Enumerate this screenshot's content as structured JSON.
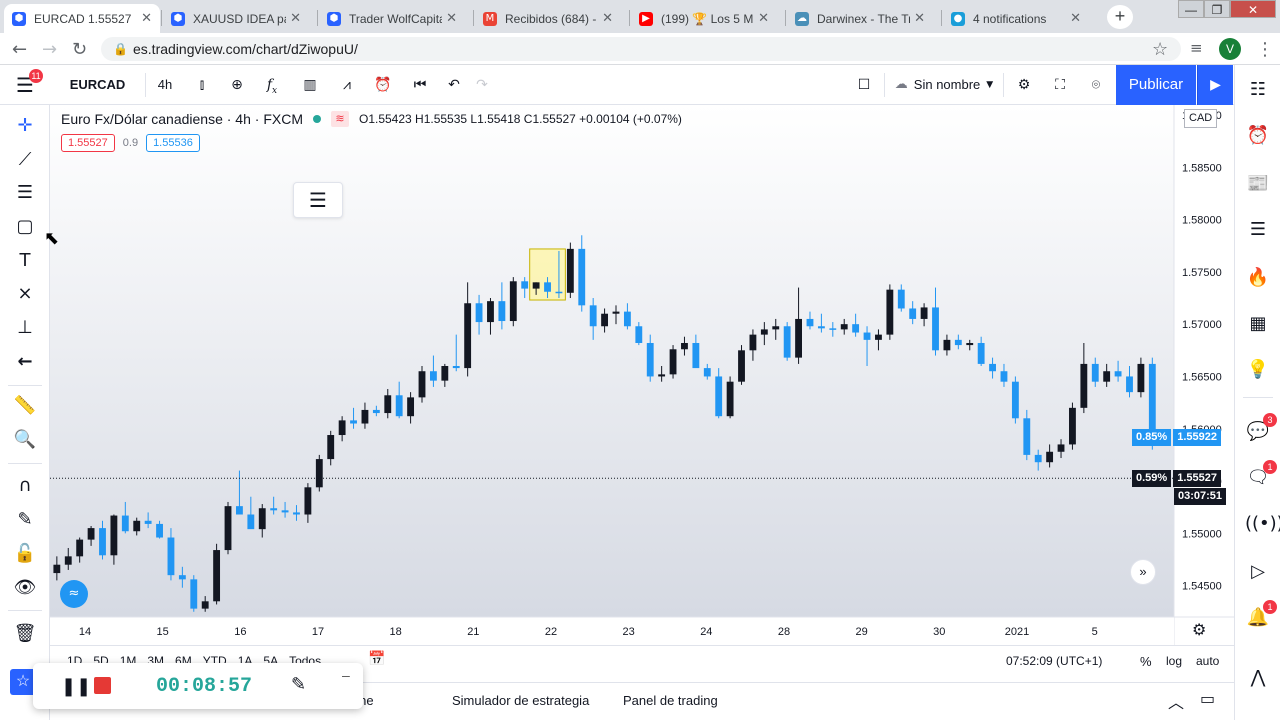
{
  "browser": {
    "tabs": [
      {
        "title": "EURCAD 1.55527 ▼",
        "favicon": "tradingview-icon",
        "color": "#2962ff"
      },
      {
        "title": "XAUUSD IDEA para",
        "favicon": "tradingview-icon",
        "color": "#2962ff"
      },
      {
        "title": "Trader WolfCapital",
        "favicon": "tradingview-icon",
        "color": "#2962ff"
      },
      {
        "title": "Recibidos (684) - s",
        "favicon": "gmail-icon",
        "color": "#ea4335"
      },
      {
        "title": "(199) 🏆 Los 5 MEJ",
        "favicon": "youtube-icon",
        "color": "#ff0000"
      },
      {
        "title": "Darwinex - The Tra",
        "favicon": "darwinex-icon",
        "color": "#4a90b8"
      },
      {
        "title": "4 notifications",
        "favicon": "notification-icon",
        "color": "#1a9ed9"
      }
    ],
    "url": "es.tradingview.com/chart/dZiwopuU/",
    "avatar_letter": "V"
  },
  "toolbar": {
    "symbol": "EURCAD",
    "interval": "4h",
    "layout_name": "Sin nombre",
    "publish": "Publicar"
  },
  "legend": {
    "title": "Euro Fx/Dólar canadiense · 4h · FXCM",
    "ohlc": "O1.55423 H1.55535 L1.55418 C1.55527 +0.00104 (+0.07%)",
    "bid": "1.55527",
    "spread": "0.9",
    "ask": "1.55536"
  },
  "price_axis": {
    "currency": "CAD",
    "ticks": [
      "1.58500",
      "1.58000",
      "1.57500",
      "1.57000",
      "1.56500",
      "1.56000",
      "1.55500",
      "1.55000",
      "1.54500"
    ],
    "partial_top": "1.59000",
    "marker1_pct": "0.85%",
    "marker1_price": "1.55922",
    "marker2_pct": "0.59%",
    "marker2_price": "1.55527",
    "countdown": "03:07:51"
  },
  "time_axis": {
    "ticks": [
      "14",
      "15",
      "16",
      "17",
      "18",
      "21",
      "22",
      "23",
      "24",
      "28",
      "29",
      "30",
      "2021",
      "5"
    ]
  },
  "bottom": {
    "ranges": [
      "1D",
      "5D",
      "1M",
      "3M",
      "6M",
      "YTD",
      "1A",
      "5A",
      "Todos"
    ],
    "clock": "07:52:09 (UTC+1)",
    "percent": "%",
    "log": "log",
    "auto": "auto"
  },
  "bottom_tabs": [
    "Editor Pine",
    "Simulador de estrategia",
    "Panel de trading"
  ],
  "recorder": {
    "time": "00:08:57"
  },
  "left_badge": "11",
  "right_badges": [
    "3",
    "1",
    "1"
  ],
  "colors": {
    "up": "#131722",
    "down": "#2196f3",
    "accent": "#2962ff",
    "highlight": "#fff59d"
  },
  "chart_data": {
    "type": "candlestick",
    "title": "Euro Fx/Dólar canadiense · 4h · FXCM",
    "ylim": [
      1.542,
      1.59
    ],
    "series": [
      {
        "name": "EURCAD",
        "values": [
          [
            1.5462,
            1.5478,
            1.5455,
            1.547
          ],
          [
            1.547,
            1.5486,
            1.5465,
            1.5478
          ],
          [
            1.5478,
            1.5496,
            1.5472,
            1.5494
          ],
          [
            1.5494,
            1.5507,
            1.5488,
            1.5505
          ],
          [
            1.5505,
            1.5512,
            1.5475,
            1.5479
          ],
          [
            1.5479,
            1.5518,
            1.547,
            1.5517
          ],
          [
            1.5517,
            1.553,
            1.55,
            1.5502
          ],
          [
            1.5502,
            1.5515,
            1.5498,
            1.5512
          ],
          [
            1.5512,
            1.552,
            1.5505,
            1.5509
          ],
          [
            1.5509,
            1.5512,
            1.5495,
            1.5496
          ],
          [
            1.5496,
            1.5505,
            1.5455,
            1.546
          ],
          [
            1.546,
            1.5468,
            1.5448,
            1.5456
          ],
          [
            1.5456,
            1.546,
            1.5425,
            1.5428
          ],
          [
            1.5428,
            1.544,
            1.5425,
            1.5435
          ],
          [
            1.5435,
            1.549,
            1.5432,
            1.5484
          ],
          [
            1.5484,
            1.553,
            1.548,
            1.5526
          ],
          [
            1.5526,
            1.556,
            1.5518,
            1.5518
          ],
          [
            1.5518,
            1.5535,
            1.551,
            1.5504
          ],
          [
            1.5504,
            1.5528,
            1.5496,
            1.5524
          ],
          [
            1.5524,
            1.5535,
            1.5518,
            1.5522
          ],
          [
            1.5522,
            1.553,
            1.5515,
            1.552
          ],
          [
            1.552,
            1.5527,
            1.5512,
            1.5518
          ],
          [
            1.5518,
            1.5548,
            1.551,
            1.5544
          ],
          [
            1.5544,
            1.5575,
            1.554,
            1.5571
          ],
          [
            1.5571,
            1.5598,
            1.5565,
            1.5594
          ],
          [
            1.5594,
            1.5612,
            1.5588,
            1.5608
          ],
          [
            1.5608,
            1.562,
            1.56,
            1.5605
          ],
          [
            1.5605,
            1.5625,
            1.56,
            1.5618
          ],
          [
            1.5618,
            1.5622,
            1.5612,
            1.5615
          ],
          [
            1.5615,
            1.5638,
            1.561,
            1.5632
          ],
          [
            1.5632,
            1.5645,
            1.561,
            1.5612
          ],
          [
            1.5612,
            1.5635,
            1.5605,
            1.563
          ],
          [
            1.563,
            1.566,
            1.5625,
            1.5655
          ],
          [
            1.5655,
            1.567,
            1.564,
            1.5646
          ],
          [
            1.5646,
            1.5662,
            1.564,
            1.566
          ],
          [
            1.566,
            1.569,
            1.5655,
            1.5658
          ],
          [
            1.5658,
            1.574,
            1.565,
            1.572
          ],
          [
            1.572,
            1.5728,
            1.569,
            1.5702
          ],
          [
            1.5702,
            1.5725,
            1.569,
            1.5722
          ],
          [
            1.5722,
            1.574,
            1.5695,
            1.5703
          ],
          [
            1.5703,
            1.5745,
            1.5698,
            1.5741
          ],
          [
            1.5741,
            1.5745,
            1.5725,
            1.5734
          ],
          [
            1.5734,
            1.574,
            1.5728,
            1.574
          ],
          [
            1.574,
            1.5745,
            1.5725,
            1.5731
          ],
          [
            1.5731,
            1.577,
            1.5725,
            1.573
          ],
          [
            1.573,
            1.5778,
            1.5725,
            1.5772
          ],
          [
            1.5772,
            1.5785,
            1.5712,
            1.5718
          ],
          [
            1.5718,
            1.5725,
            1.5685,
            1.5698
          ],
          [
            1.5698,
            1.5715,
            1.5692,
            1.571
          ],
          [
            1.571,
            1.5718,
            1.57,
            1.5712
          ],
          [
            1.5712,
            1.572,
            1.5695,
            1.5698
          ],
          [
            1.5698,
            1.5702,
            1.568,
            1.5682
          ],
          [
            1.5682,
            1.569,
            1.5645,
            1.565
          ],
          [
            1.565,
            1.566,
            1.5645,
            1.5652
          ],
          [
            1.5652,
            1.568,
            1.5648,
            1.5676
          ],
          [
            1.5676,
            1.5688,
            1.567,
            1.5682
          ],
          [
            1.5682,
            1.569,
            1.566,
            1.5658
          ],
          [
            1.5658,
            1.5662,
            1.5647,
            1.565
          ],
          [
            1.565,
            1.5658,
            1.561,
            1.5612
          ],
          [
            1.5612,
            1.565,
            1.561,
            1.5645
          ],
          [
            1.5645,
            1.568,
            1.5642,
            1.5675
          ],
          [
            1.5675,
            1.5695,
            1.5665,
            1.569
          ],
          [
            1.569,
            1.5702,
            1.568,
            1.5695
          ],
          [
            1.5695,
            1.5705,
            1.5685,
            1.5698
          ],
          [
            1.5698,
            1.5702,
            1.5665,
            1.5668
          ],
          [
            1.5668,
            1.5735,
            1.5662,
            1.5705
          ],
          [
            1.5705,
            1.5712,
            1.5695,
            1.5698
          ],
          [
            1.5698,
            1.571,
            1.5692,
            1.5696
          ],
          [
            1.5696,
            1.5702,
            1.5688,
            1.5695
          ],
          [
            1.5695,
            1.5705,
            1.569,
            1.57
          ],
          [
            1.57,
            1.571,
            1.5688,
            1.5692
          ],
          [
            1.5692,
            1.5698,
            1.566,
            1.5685
          ],
          [
            1.5685,
            1.5695,
            1.5675,
            1.569
          ],
          [
            1.569,
            1.5738,
            1.5685,
            1.5733
          ],
          [
            1.5733,
            1.5738,
            1.5712,
            1.5715
          ],
          [
            1.5715,
            1.5722,
            1.57,
            1.5705
          ],
          [
            1.5705,
            1.572,
            1.5698,
            1.5716
          ],
          [
            1.5716,
            1.5735,
            1.567,
            1.5675
          ],
          [
            1.5675,
            1.569,
            1.567,
            1.5685
          ],
          [
            1.5685,
            1.569,
            1.5676,
            1.568
          ],
          [
            1.568,
            1.5685,
            1.5675,
            1.5682
          ],
          [
            1.5682,
            1.5688,
            1.566,
            1.5662
          ],
          [
            1.5662,
            1.5668,
            1.5648,
            1.5655
          ],
          [
            1.5655,
            1.5662,
            1.564,
            1.5645
          ],
          [
            1.5645,
            1.565,
            1.5605,
            1.561
          ],
          [
            1.561,
            1.5618,
            1.557,
            1.5575
          ],
          [
            1.5575,
            1.558,
            1.556,
            1.5568
          ],
          [
            1.5568,
            1.5585,
            1.5563,
            1.5578
          ],
          [
            1.5578,
            1.559,
            1.5572,
            1.5585
          ],
          [
            1.5585,
            1.5625,
            1.558,
            1.562
          ],
          [
            1.562,
            1.5682,
            1.5615,
            1.5662
          ],
          [
            1.5662,
            1.5668,
            1.564,
            1.5645
          ],
          [
            1.5645,
            1.5662,
            1.564,
            1.5655
          ],
          [
            1.5655,
            1.5665,
            1.5645,
            1.565
          ],
          [
            1.565,
            1.566,
            1.563,
            1.5635
          ],
          [
            1.5635,
            1.5668,
            1.563,
            1.5662
          ],
          [
            1.5662,
            1.5668,
            1.558,
            1.55922
          ]
        ]
      }
    ],
    "highlight_range": [
      42,
      44
    ]
  }
}
